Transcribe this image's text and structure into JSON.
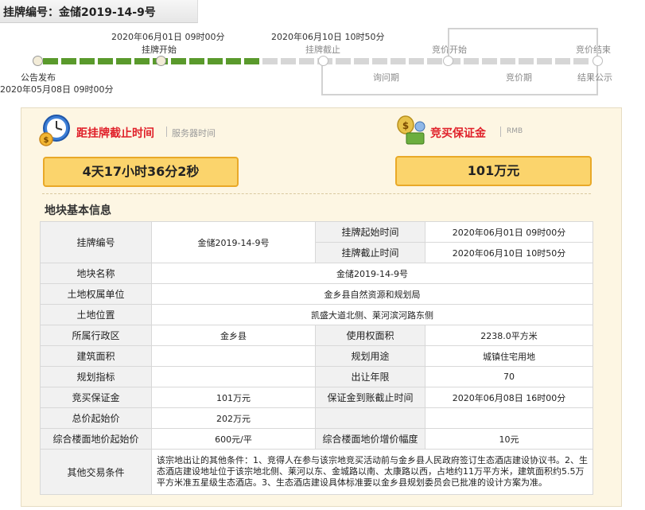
{
  "header": {
    "label": "挂牌编号：",
    "code": "金储2019-14-9号"
  },
  "timeline": {
    "announce": {
      "label": "公告发布",
      "date": "2020年05月08日 09时00分"
    },
    "listing_start": {
      "label": "挂牌开始",
      "date": "2020年06月01日 09时00分"
    },
    "listing_end": {
      "label": "挂牌截止",
      "date": "2020年06月10日 10时50分"
    },
    "bid_start": "竞价开始",
    "bid_end": "竞价结束",
    "inquiry_period": "询问期",
    "bid_period": "竞价期",
    "result": "结果公示",
    "progress": 0.37
  },
  "countdown": {
    "title": "距挂牌截止时间",
    "sub": "服务器时间",
    "value": "4天17小时36分2秒"
  },
  "deposit": {
    "title": "竞买保证金",
    "sub": "RMB",
    "value": "101万元"
  },
  "info": {
    "title": "地块基本信息",
    "rows": {
      "listing_no_label": "挂牌编号",
      "listing_no": "金储2019-14-9号",
      "listing_start_label": "挂牌起始时间",
      "listing_start": "2020年06月01日 09时00分",
      "listing_end_label": "挂牌截止时间",
      "listing_end": "2020年06月10日 10时50分",
      "parcel_name_label": "地块名称",
      "parcel_name": "金储2019-14-9号",
      "owner_label": "土地权属单位",
      "owner": "金乡县自然资源和规划局",
      "location_label": "土地位置",
      "location": "凯盛大道北侧、莱河滨河路东侧",
      "district_label": "所属行政区",
      "district": "金乡县",
      "area_label": "使用权面积",
      "area": "2238.0平方米",
      "build_area_label": "建筑面积",
      "build_area": "",
      "use_label": "规划用途",
      "use": "城镇住宅用地",
      "index_label": "规划指标",
      "index": "",
      "years_label": "出让年限",
      "years": "70",
      "deposit_label": "竞买保证金",
      "deposit": "101万元",
      "deposit_deadline_label": "保证金到账截止时间",
      "deposit_deadline": "2020年06月08日 16时00分",
      "start_price_label": "总价起始价",
      "start_price": "202万元",
      "floor_price_label": "综合楼面地价起始价",
      "floor_price": "600元/平",
      "increment_label": "综合楼面地价增价幅度",
      "increment": "10元",
      "other_label": "其他交易条件",
      "other": "该宗地出让的其他条件：1、竞得人在参与该宗地竞买活动前与金乡县人民政府签订生态酒店建设协议书。2、生态酒店建设地址位于该宗地北侧、莱河以东、金城路以南、太康路以西，占地约11万平方米，建筑面积约5.5万平方米准五星级生态酒店。3、生态酒店建设具体标准要以金乡县规划委员会已批准的设计方案为准。"
    }
  },
  "colors": {
    "progress": "#5a9a2c",
    "pending": "#d6d6d6",
    "accent": "#e0202a",
    "box": "#fbd46c"
  }
}
